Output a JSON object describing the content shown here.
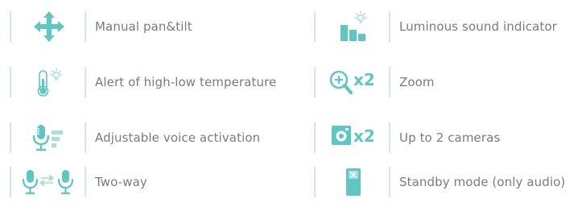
{
  "features": [
    {
      "label": "Manual pan&tilt",
      "icon": "pan-tilt-arrows-icon"
    },
    {
      "label": "Luminous sound indicator",
      "icon": "light-sound-level-icon"
    },
    {
      "label": "Alert of high-low temperature",
      "icon": "thermometer-light-icon"
    },
    {
      "label": "Zoom",
      "icon": "zoom-in-icon",
      "icon_suffix": "x2"
    },
    {
      "label": "Adjustable voice activation",
      "icon": "microphone-levels-icon"
    },
    {
      "label": "Up to 2 cameras",
      "icon": "camera-icon",
      "icon_suffix": "x2"
    },
    {
      "label": "Two-way",
      "icon": "two-way-microphone-icon"
    },
    {
      "label": "Standby mode (only audio)",
      "icon": "standby-device-icon"
    }
  ],
  "colors": {
    "accent": "#5fc6c2",
    "accent_light": "#a9ddda",
    "divider": "#cfe9eb",
    "text": "#7b7b7b"
  }
}
